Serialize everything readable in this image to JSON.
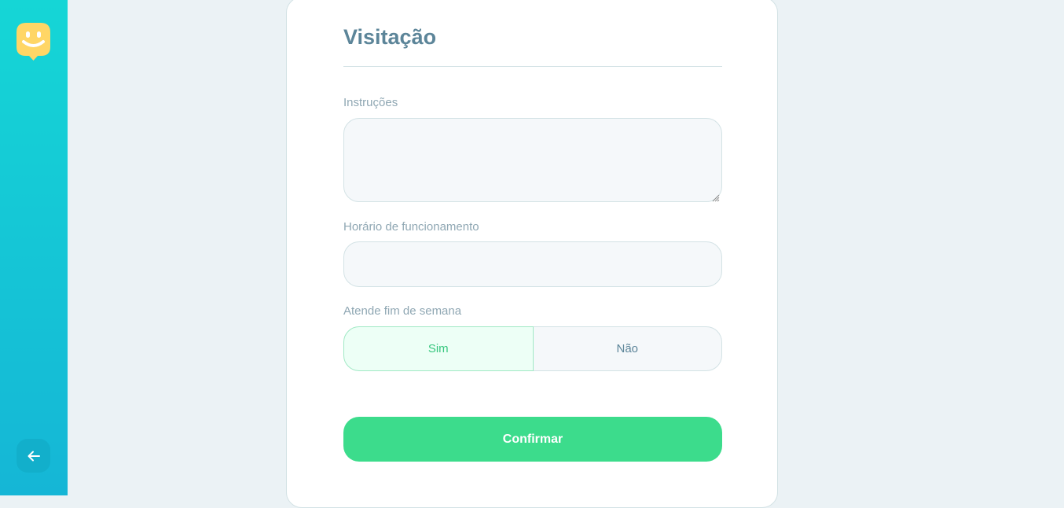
{
  "sidebar": {
    "logo_icon": "smiley-marker-icon",
    "back_icon": "arrow-left-icon",
    "colors": {
      "gradient_top": "#15d6d6",
      "gradient_bottom": "#15b6d6",
      "logo": "#ffd666"
    }
  },
  "form": {
    "title": "Visitação",
    "instructions": {
      "label": "Instruções",
      "value": ""
    },
    "opening_hours": {
      "label": "Horário de funcionamento",
      "value": ""
    },
    "weekends": {
      "label": "Atende fim de semana",
      "options": [
        "Sim",
        "Não"
      ],
      "selected": "Sim"
    },
    "confirm_label": "Confirmar"
  },
  "colors": {
    "accent_green": "#3cdc8c",
    "title": "#5c8599",
    "label": "#8fa7b3",
    "background": "#ebf2f5"
  }
}
